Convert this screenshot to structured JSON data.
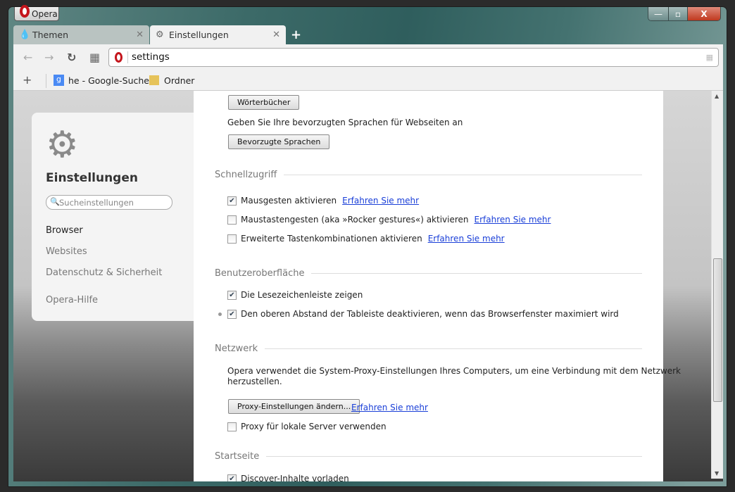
{
  "window": {
    "title_button": "Opera",
    "minimize": "—",
    "maximize": "▫",
    "close": "X"
  },
  "tabs": [
    {
      "label": "Themen",
      "icon": "drop-icon",
      "close": "✕"
    },
    {
      "label": "Einstellungen",
      "icon": "gear-icon",
      "close": "✕"
    }
  ],
  "new_tab": "+",
  "toolbar": {
    "back": "←",
    "forward": "→",
    "reload": "↻",
    "speed_dial": "▦",
    "url": "settings",
    "grid": "▦"
  },
  "bookmarks": {
    "add": "+",
    "items": [
      {
        "label": "he - Google-Suche",
        "icon": "google-icon"
      },
      {
        "label": "Ordner",
        "icon": "folder-icon"
      }
    ]
  },
  "sidebar": {
    "title": "Einstellungen",
    "search_placeholder": "Sucheinstellungen",
    "items": [
      "Browser",
      "Websites",
      "Datenschutz & Sicherheit",
      "Opera-Hilfe"
    ],
    "active": "Browser"
  },
  "main": {
    "dict_button": "Wörterbücher",
    "lang_text": "Geben Sie Ihre bevorzugten Sprachen für Webseiten an",
    "lang_button": "Bevorzugte Sprachen",
    "quick": {
      "title": "Schnellzugriff",
      "items": [
        {
          "label": "Mausgesten aktivieren",
          "checked": true,
          "link": "Erfahren Sie mehr"
        },
        {
          "label": "Maustastengesten (aka »Rocker gestures«) aktivieren",
          "checked": false,
          "link": "Erfahren Sie mehr"
        },
        {
          "label": "Erweiterte Tastenkombinationen aktivieren",
          "checked": false,
          "link": "Erfahren Sie mehr"
        }
      ]
    },
    "ui": {
      "title": "Benutzeroberfläche",
      "items": [
        {
          "label": "Die Lesezeichenleiste zeigen",
          "checked": true
        },
        {
          "label": "Den oberen Abstand der Tableiste deaktivieren, wenn das Browserfenster maximiert wird",
          "checked": true
        }
      ]
    },
    "network": {
      "title": "Netzwerk",
      "text1": "Opera verwendet die System-Proxy-Einstellungen Ihres Computers, um eine Verbindung mit dem Netzwerk",
      "text2": "herzustellen.",
      "button": "Proxy-Einstellungen ändern...",
      "link": "Erfahren Sie mehr",
      "proxy_local": {
        "label": "Proxy für lokale Server verwenden",
        "checked": false
      }
    },
    "start": {
      "title": "Startseite",
      "items": [
        {
          "label": "Discover-Inhalte vorladen",
          "checked": true
        }
      ]
    }
  }
}
